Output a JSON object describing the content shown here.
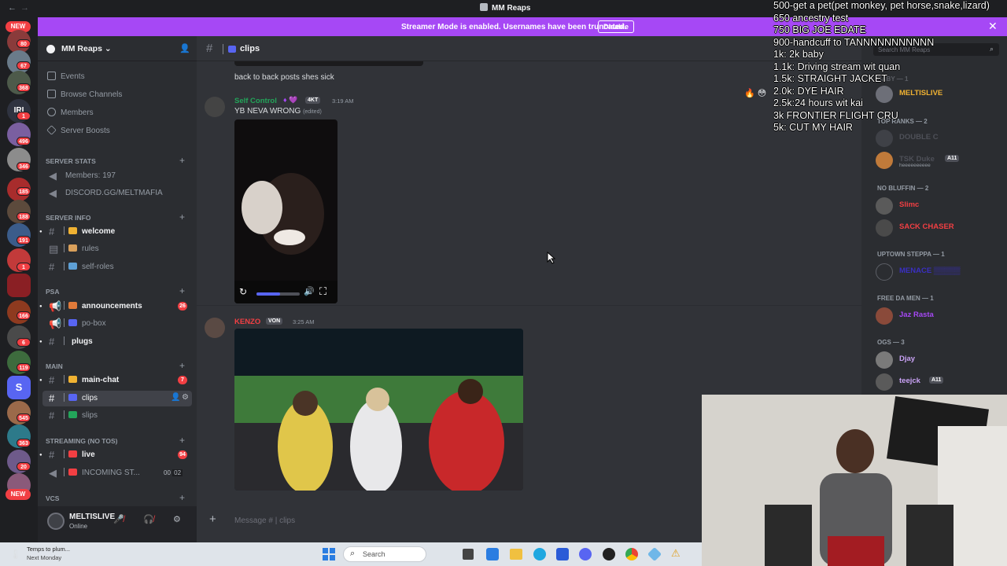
{
  "window": {
    "title": "MM Reaps",
    "back_glyph": "←",
    "forward_glyph": "→"
  },
  "streamer_banner": {
    "text": "Streamer Mode is enabled. Usernames have been truncated.",
    "button": "Disable",
    "close_glyph": "✕",
    "color": "#a648f5"
  },
  "guilds": {
    "top_badge": "NEW",
    "bottom_badge": "NEW",
    "badges": [
      "80",
      "67",
      "368",
      "1",
      "496",
      "346",
      "185",
      "188",
      "191",
      "1",
      "166",
      "6",
      "119",
      "545",
      "363",
      "20"
    ]
  },
  "server": {
    "name": "MM Reaps",
    "chevron": "⌄",
    "nav": [
      {
        "label": "Events",
        "icon": "calendar-icon"
      },
      {
        "label": "Browse Channels",
        "icon": "browse-channels-icon"
      },
      {
        "label": "Members",
        "icon": "members-icon"
      },
      {
        "label": "Server Boosts",
        "icon": "boost-icon"
      }
    ],
    "categories": {
      "server_stats": "SERVER STATS",
      "server_info": "SERVER INFO",
      "psa": "PSA",
      "main": "MAIN",
      "streaming": "STREAMING (NO TOS)",
      "vcs": "VCs"
    },
    "stats": {
      "members": "Members: 197",
      "discord": "DISCORD.GG/MELTMAFIA"
    },
    "channels": {
      "welcome": "welcome",
      "rules": "rules",
      "self_roles": "self-roles",
      "announcements": "announcements",
      "announcements_mentions": "26",
      "po_box": "po-box",
      "plugs": "plugs",
      "main_chat": "main-chat",
      "main_chat_mentions": "7",
      "clips": "clips",
      "slips": "slips",
      "live": "live",
      "live_mentions": "94",
      "incoming": "INCOMING ST...",
      "incoming_users": "00",
      "incoming_limit": "02"
    },
    "plus_glyph": "+"
  },
  "user_panel": {
    "name": "MELTISLIVE",
    "status": "Online"
  },
  "channel_header": {
    "name": "clips",
    "hash": "#"
  },
  "messages": [
    {
      "text": "back to back posts shes sick"
    },
    {
      "author": "Self Control",
      "tag": "4KT",
      "time": "3:19 AM",
      "text": "YB NEVA WRONG",
      "edited": "(edited)",
      "video_progress": 0.55
    },
    {
      "author": "KENZO",
      "tag": "VON",
      "time": "3:25 AM"
    }
  ],
  "composer": {
    "placeholder": "Message # | clips",
    "plus_glyph": "+"
  },
  "members_list": {
    "search_placeholder": "Search MM Reaps",
    "group_baby": "Baby — 1",
    "group_top_ranks": "Top Ranks — 2",
    "group_no_bluffin": "No Bluffin — 2",
    "group_uptown": "Uptown Steppa — 1",
    "group_free_da_men": "Free Da Men — 1",
    "group_ogs": "OGs — 3",
    "meltislive": "MELTISLIVE",
    "double_c": "DOUBLE C",
    "tsk_duke": "TSK Duke",
    "tsk_duke_tag": "A11",
    "tsk_duke_status": "heeeeeeeeee",
    "slimc": "Slimc",
    "sack_chaser": "SACK CHASER",
    "uptown_user": "MENACE ▒▒▒▒▒",
    "free_user": "Jaz Rasta",
    "djay": "Djay",
    "teejck": "teejck",
    "teejck_tag": "A11"
  },
  "stream_overlay": {
    "goals": [
      "500-get a pet(pet monkey, pet horse,snake,lizard)",
      "650 ancestry test",
      "750 BIG JOE EDATE",
      "900-handcuff to TANNNNNNNNNNN",
      "1k: 2k baby",
      "1.1k: Driving stream wit quan",
      "1.5k: STRAIGHT JACKET",
      "2.0k: DYE HAIR",
      "2.5k:24 hours wit kai",
      "3k FRONTIER FLIGHT CRU",
      "5k: CUT MY HAIR"
    ]
  },
  "taskbar": {
    "weather_line1": "Temps to plum...",
    "weather_line2": "Next Monday",
    "search": "Search"
  },
  "colors": {
    "accent": "#5865f2",
    "mention_red": "#f23f43",
    "online_green": "#23a55a",
    "banner_purple": "#a648f5"
  }
}
